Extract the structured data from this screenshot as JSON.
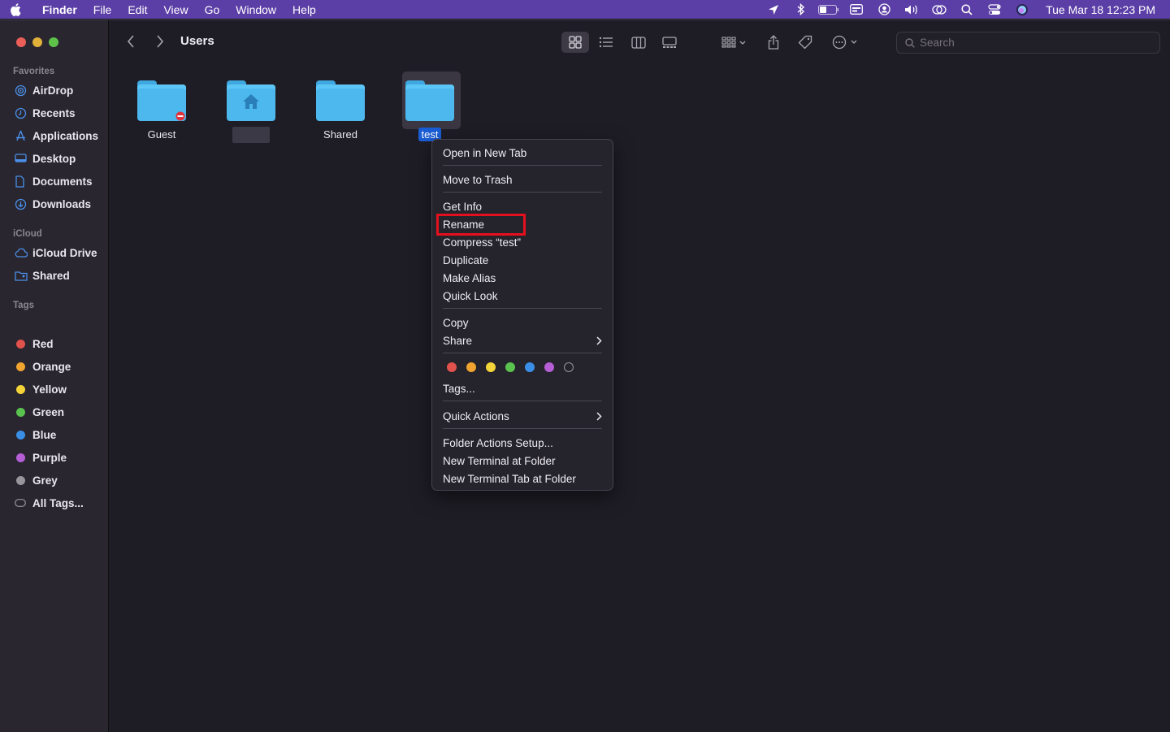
{
  "menubar": {
    "app_name": "Finder",
    "menus": [
      "File",
      "Edit",
      "View",
      "Go",
      "Window",
      "Help"
    ],
    "clock": "Tue Mar 18  12:23 PM"
  },
  "sidebar": {
    "favorites_title": "Favorites",
    "favorites": [
      "AirDrop",
      "Recents",
      "Applications",
      "Desktop",
      "Documents",
      "Downloads"
    ],
    "icloud_title": "iCloud",
    "icloud": [
      "iCloud Drive",
      "Shared"
    ],
    "tags_title": "Tags",
    "tags": [
      {
        "label": "Red",
        "color": "#e2524d"
      },
      {
        "label": "Orange",
        "color": "#f0a32f"
      },
      {
        "label": "Yellow",
        "color": "#f4d438"
      },
      {
        "label": "Green",
        "color": "#5ac34f"
      },
      {
        "label": "Blue",
        "color": "#3b8ee6"
      },
      {
        "label": "Purple",
        "color": "#b55ed6"
      },
      {
        "label": "Grey",
        "color": "#98969c"
      }
    ],
    "all_tags": "All Tags..."
  },
  "toolbar": {
    "title": "Users",
    "search_placeholder": "Search"
  },
  "items": [
    {
      "label": "Guest"
    },
    {
      "label": ""
    },
    {
      "label": "Shared"
    },
    {
      "label": "test"
    }
  ],
  "context_menu": {
    "open_new_tab": "Open in New Tab",
    "move_to_trash": "Move to Trash",
    "get_info": "Get Info",
    "rename": "Rename",
    "compress": "Compress “test”",
    "duplicate": "Duplicate",
    "make_alias": "Make Alias",
    "quick_look": "Quick Look",
    "copy": "Copy",
    "share": "Share",
    "tags": "Tags...",
    "quick_actions": "Quick Actions",
    "folder_actions": "Folder Actions Setup...",
    "new_terminal": "New Terminal at Folder",
    "new_terminal_tab": "New Terminal Tab at Folder",
    "tag_colors": [
      "#e2524d",
      "#f0a32f",
      "#f4d438",
      "#5ac34f",
      "#3b8ee6",
      "#b55ed6"
    ]
  }
}
